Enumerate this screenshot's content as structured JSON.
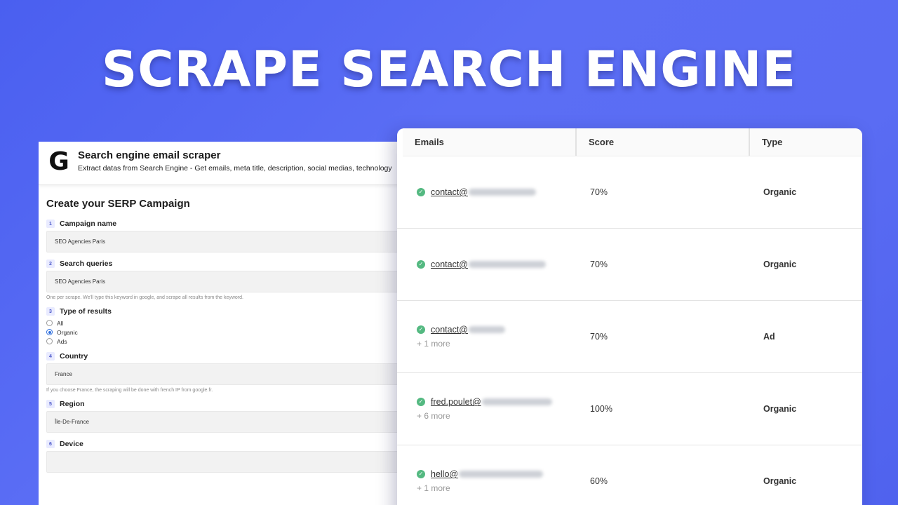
{
  "headline": "SCRAPE SEARCH ENGINE",
  "form": {
    "logo_letter": "G",
    "title": "Search engine email scraper",
    "subtitle": "Extract datas from Search Engine - Get emails, meta title, description, social medias, technology",
    "section_title": "Create your SERP Campaign",
    "fields": [
      {
        "num": "1",
        "label": "Campaign name",
        "value": "SEO Agencies Paris",
        "hint": ""
      },
      {
        "num": "2",
        "label": "Search queries",
        "value": "SEO Agencies Paris",
        "hint": "One per scrape. We'll type this keyword in google, and scrape all results from the keyword."
      },
      {
        "num": "4",
        "label": "Country",
        "value": "France",
        "hint": "If you choose France, the scraping will be done with french IP from google.fr."
      },
      {
        "num": "5",
        "label": "Region",
        "value": "Île-De-France",
        "hint": ""
      },
      {
        "num": "6",
        "label": "Device",
        "value": "",
        "hint": ""
      }
    ],
    "type_of_results": {
      "num": "3",
      "label": "Type of results",
      "options": [
        "All",
        "Organic",
        "Ads"
      ],
      "selected": "Organic"
    }
  },
  "results": {
    "columns": [
      "Emails",
      "Score",
      "Type"
    ],
    "rows": [
      {
        "email_local": "contact@",
        "more": "",
        "score": "70%",
        "type": "Organic"
      },
      {
        "email_local": "contact@",
        "more": "",
        "score": "70%",
        "type": "Organic"
      },
      {
        "email_local": "contact@",
        "more": "+ 1 more",
        "score": "70%",
        "type": "Ad"
      },
      {
        "email_local": "fred.poulet@",
        "more": "+ 6 more",
        "score": "100%",
        "type": "Organic"
      },
      {
        "email_local": "hello@",
        "more": "+ 1 more",
        "score": "60%",
        "type": "Organic"
      }
    ]
  },
  "icons": {
    "verified": "check-circle-icon"
  },
  "colors": {
    "background": "#5a6cf3",
    "verified_green": "#54b981",
    "radio_blue": "#2f6fde"
  }
}
